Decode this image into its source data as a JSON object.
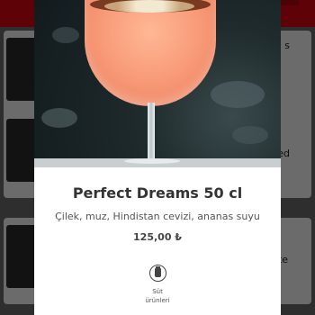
{
  "product": {
    "name": "Perfect Dreams 50 cl",
    "description": "Çilek, muz, Hindistan cevizi, ananas suyu",
    "price": "125,00 ₺"
  },
  "allergens": [
    {
      "label_line1": "Süt",
      "label_line2": "ürünleri",
      "icon": "milk-carton-icon"
    }
  ],
  "background_list": {
    "item_fragments": [
      "s",
      "ed",
      "te"
    ]
  },
  "colors": {
    "brand_red": "#e30613",
    "overlay": "rgba(0,0,0,0.58)",
    "title_text": "#333333"
  }
}
